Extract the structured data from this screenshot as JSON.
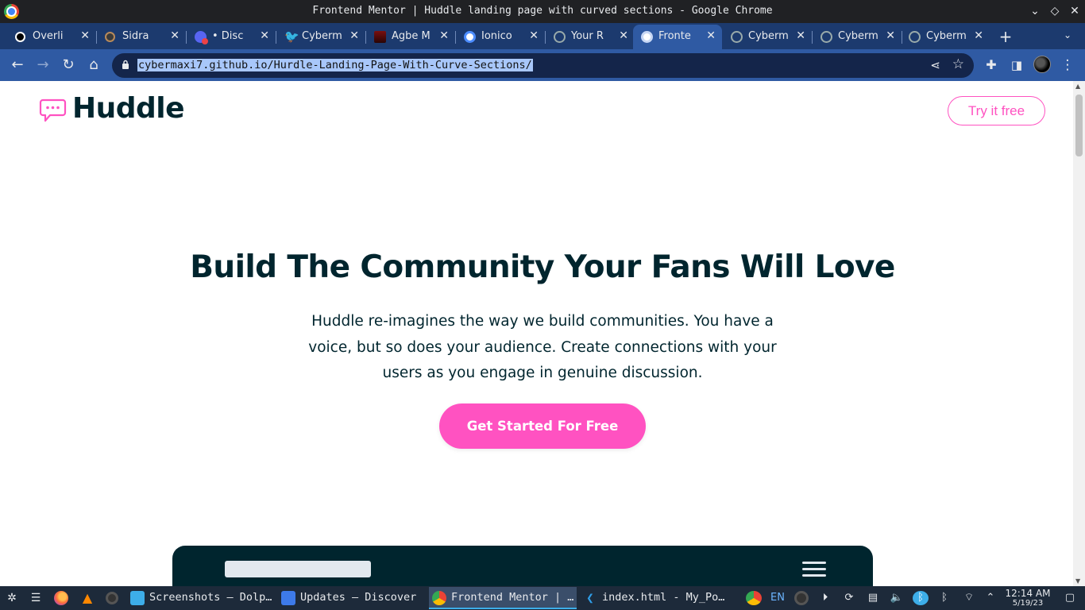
{
  "window": {
    "title": "Frontend Mentor | Huddle landing page with curved sections - Google Chrome",
    "controls": [
      "chevron-down",
      "restore",
      "close"
    ]
  },
  "tabs": [
    {
      "label": "Overli",
      "favicon": "threads-icon",
      "active": false
    },
    {
      "label": "Sidra",
      "favicon": "gear-icon",
      "active": false
    },
    {
      "label": "• Disc",
      "favicon": "discord-icon",
      "active": false
    },
    {
      "label": "Cyberm",
      "favicon": "twitter-icon",
      "active": false
    },
    {
      "label": "Agbe M",
      "favicon": "anime-icon",
      "active": false
    },
    {
      "label": "Ionico",
      "favicon": "ionicons-icon",
      "active": false
    },
    {
      "label": "Your R",
      "favicon": "github-icon",
      "active": false
    },
    {
      "label": "Fronte",
      "favicon": "frontend-mentor-icon",
      "active": true
    },
    {
      "label": "Cyberm",
      "favicon": "github-icon",
      "active": false
    },
    {
      "label": "Cyberm",
      "favicon": "github-icon",
      "active": false
    },
    {
      "label": "Cyberm",
      "favicon": "github-icon",
      "active": false
    }
  ],
  "toolbar": {
    "url": "cybermaxi7.github.io/Hurdle-Landing-Page-With-Curve-Sections/"
  },
  "page": {
    "logo_text": "Huddle",
    "try_button": "Try it free",
    "hero_title": "Build The Community Your Fans Will Love",
    "hero_line1": "Huddle re-imagines the way we build communities. You have a",
    "hero_line2": "voice, but so does your audience. Create connections with your",
    "hero_line3": "users as you engage in genuine discussion.",
    "cta_button": "Get Started For Free",
    "colors": {
      "brand_pink": "#ff52c1",
      "dark_cyan": "#00252e"
    }
  },
  "taskbar": {
    "tasks": [
      {
        "label": "Screenshots — Dolp…",
        "icon": "folder-icon",
        "active": false
      },
      {
        "label": "Updates — Discover",
        "icon": "discover-icon",
        "active": false
      },
      {
        "label": "Frontend Mentor | …",
        "icon": "chrome-icon",
        "active": true
      },
      {
        "label": "index.html - My_Po…",
        "icon": "vscode-icon",
        "active": false
      }
    ],
    "lang": "EN",
    "time": "12:14 AM",
    "date": "5/19/23"
  }
}
